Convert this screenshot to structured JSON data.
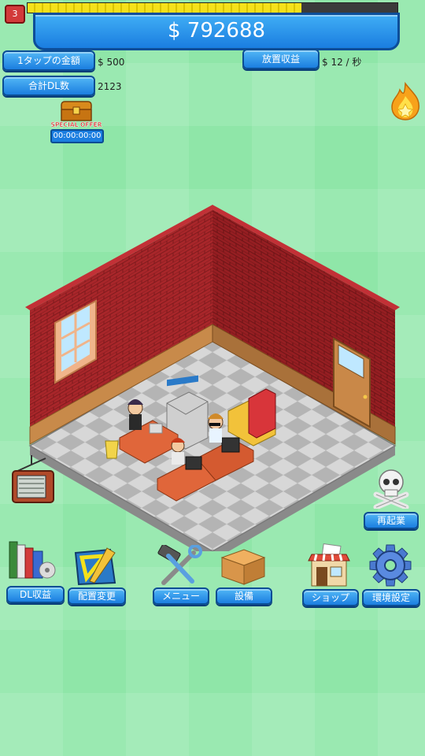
{
  "hud": {
    "level": "3",
    "xp_progress": 0.74,
    "money": "$ 792688"
  },
  "stats": {
    "tap_amount_label": "1タップの金額",
    "tap_amount_value": "$ 500",
    "total_dl_label": "合計DL数",
    "total_dl_value": "2123",
    "idle_income_label": "放置収益",
    "idle_income_value": "$ 12 / 秒"
  },
  "special_offer": {
    "label": "SPECIAL OFFER",
    "timer": "00:00:00:00"
  },
  "actions": {
    "restart_label": "再起業",
    "dl_income_label": "DL収益",
    "layout_label": "配置変更",
    "menu_label": "メニュー",
    "equipment_label": "設備",
    "shop_label": "ショップ",
    "settings_label": "環境設定"
  },
  "icons": {
    "flame": "flame-star-icon",
    "tv": "tv-icon",
    "skull": "skull-crossbones-icon",
    "chest": "treasure-chest-icon"
  },
  "colors": {
    "background": "#8fe6a8",
    "button_blue": "#1b7ee0",
    "brick": "#a8262a",
    "xp_yellow": "#f5e11b"
  }
}
